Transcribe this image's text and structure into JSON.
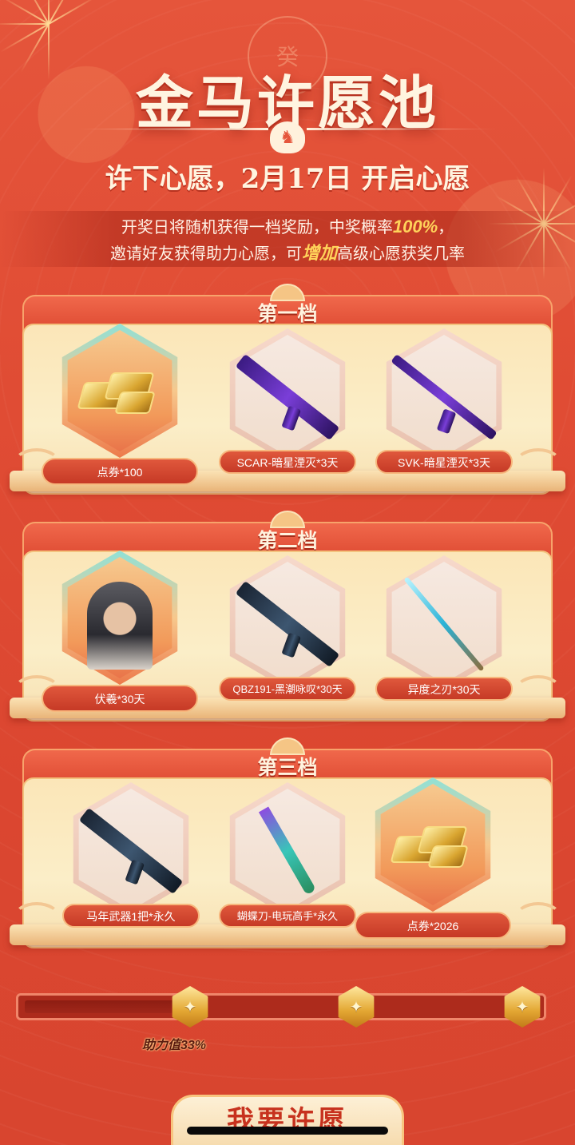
{
  "header": {
    "emblem_char": "癸",
    "title": "金马许愿池",
    "horse_icon": "horse-icon",
    "subtitle": "许下心愿，2月17日 开启心愿"
  },
  "description": {
    "line1_before": "开奖日将随机获得一档奖励，中奖概率",
    "line1_highlight": "100%",
    "line1_after": "，",
    "line2_before": "邀请好友获得助力心愿，可",
    "line2_highlight": "增加",
    "line2_after": "高级心愿获奖几率"
  },
  "colors": {
    "background": "#e04c34",
    "highlight": "#ffd35a",
    "panel": "#fbe6b8",
    "label": "#c63a26"
  },
  "tiers": [
    {
      "title": "第一档",
      "items": [
        {
          "label": "点券*100",
          "icon": "gold-coins-icon",
          "featured": true
        },
        {
          "label": "SCAR-暗星湮灭*3天",
          "icon": "rifle-icon",
          "featured": false
        },
        {
          "label": "SVK-暗星湮灭*3天",
          "icon": "sniper-rifle-icon",
          "featured": false
        }
      ]
    },
    {
      "title": "第二档",
      "items": [
        {
          "label": "伏羲*30天",
          "icon": "character-avatar-icon",
          "featured": true
        },
        {
          "label": "QBZ191-黑潮咏叹*30天",
          "icon": "rifle-icon",
          "featured": false
        },
        {
          "label": "异度之刃*30天",
          "icon": "blade-icon",
          "featured": false
        }
      ]
    },
    {
      "title": "第三档",
      "items": [
        {
          "label": "马年武器1把*永久",
          "icon": "rifle-icon",
          "featured": false
        },
        {
          "label": "蝴蝶刀-电玩高手*永久",
          "icon": "butterfly-knife-icon",
          "featured": false
        },
        {
          "label": "点券*2026",
          "icon": "gold-coins-icon",
          "featured": true
        }
      ]
    }
  ],
  "progress": {
    "value": 0.33,
    "label": "助力值33%",
    "milestones": 3,
    "milestone_icon": "helmet-icon"
  },
  "wish_button": {
    "label": "我要许愿"
  }
}
